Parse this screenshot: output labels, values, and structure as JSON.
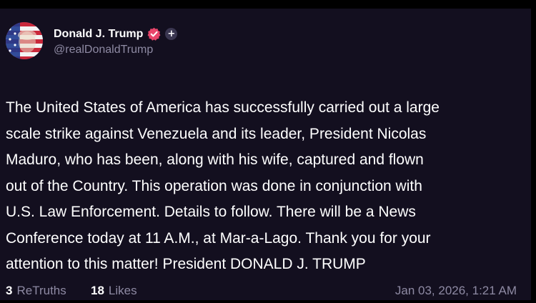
{
  "post": {
    "author": {
      "display_name": "Donald J. Trump",
      "handle": "@realDonaldTrump",
      "avatar_icon": "american-flag-portrait-avatar",
      "verified_icon": "verified-badge-icon",
      "follow_icon": "plus-icon"
    },
    "text_lines": [
      "The United States of America has successfully carried out a large",
      "scale strike against Venezuela and its leader, President Nicolas",
      "Maduro, who has been, along with his wife, captured and flown",
      "out of the Country. This operation was done in conjunction with",
      "U.S. Law Enforcement. Details to follow. There will be a News",
      "Conference today at 11 A.M., at Mar-a-Lago. Thank you for your",
      "attention to this matter! President DONALD J. TRUMP"
    ],
    "stats": {
      "retruths_count": "3",
      "retruths_label": "ReTruths",
      "likes_count": "18",
      "likes_label": "Likes"
    },
    "timestamp": "Jan 03, 2026, 1:21 AM"
  },
  "colors": {
    "background": "#000000",
    "card": "#130f1f",
    "text": "#ffffff",
    "muted": "#8e8aa3",
    "verified_badge": "#e8456b"
  }
}
